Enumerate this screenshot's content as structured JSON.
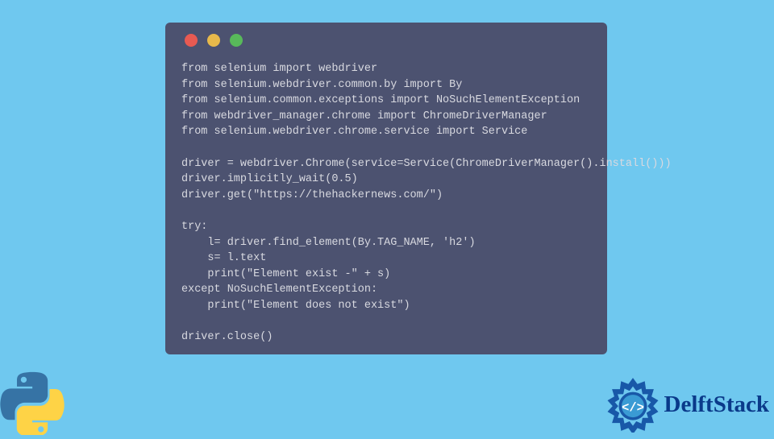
{
  "code": {
    "lines": [
      "from selenium import webdriver",
      "from selenium.webdriver.common.by import By",
      "from selenium.common.exceptions import NoSuchElementException",
      "from webdriver_manager.chrome import ChromeDriverManager",
      "from selenium.webdriver.chrome.service import Service",
      "",
      "driver = webdriver.Chrome(service=Service(ChromeDriverManager().install()))",
      "driver.implicitly_wait(0.5)",
      "driver.get(\"https://thehackernews.com/\")",
      "",
      "try:",
      "    l= driver.find_element(By.TAG_NAME, 'h2')",
      "    s= l.text",
      "    print(\"Element exist -\" + s)",
      "except NoSuchElementException:",
      "    print(\"Element does not exist\")",
      "",
      "driver.close()"
    ]
  },
  "brand": {
    "name": "DelftStack"
  }
}
